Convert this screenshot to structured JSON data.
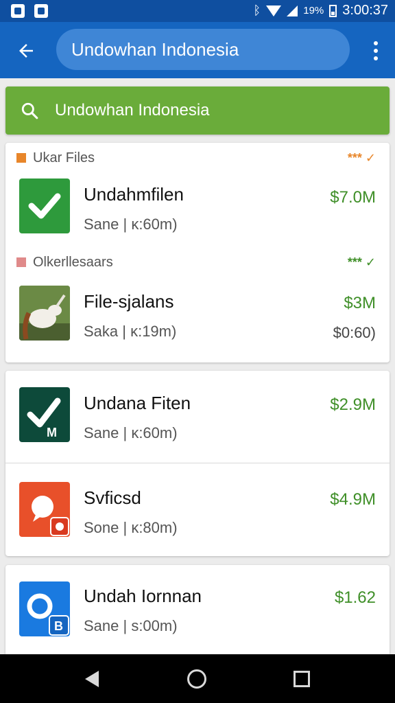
{
  "status_bar": {
    "battery_text": "19%",
    "time": "3:00:37"
  },
  "app_bar": {
    "back_icon": "arrow-back-icon",
    "search_text": "Undowhan Indonesia",
    "menu_icon": "more-vert-icon"
  },
  "search_banner": {
    "icon": "search-icon",
    "text": "Undowhan Indonesia",
    "color": "#6aac3a"
  },
  "sections": [
    {
      "title": "Ukar Files",
      "dot_color": "#e8862a",
      "meta": "*** ✓",
      "meta_color": "#e8862a"
    },
    {
      "title": "Olkerllesaars",
      "dot_color": "#e08a8a",
      "meta": "*** ✓",
      "meta_color": "#3f8f28"
    }
  ],
  "items": [
    {
      "name": "Undahmfilen",
      "sub": "Sane | κ:60m)",
      "price": "$7.0M"
    },
    {
      "name": "File-sjalans",
      "sub": "Saka | κ:19m)",
      "price": "$3M",
      "price2": "$0:60)"
    },
    {
      "name": "Undana Fiten",
      "sub": "Sane | κ:60m)",
      "price": "$2.9M"
    },
    {
      "name": "Svficsd",
      "sub": "Sone | κ:80m)",
      "price": "$4.9M"
    },
    {
      "name": "Undah Iornnan",
      "sub": "Sane | s:00m)",
      "price": "$1.62"
    }
  ],
  "colors": {
    "primary": "#1565c0",
    "status_bar": "#0f4fa0",
    "accent_green": "#3f8f28"
  }
}
